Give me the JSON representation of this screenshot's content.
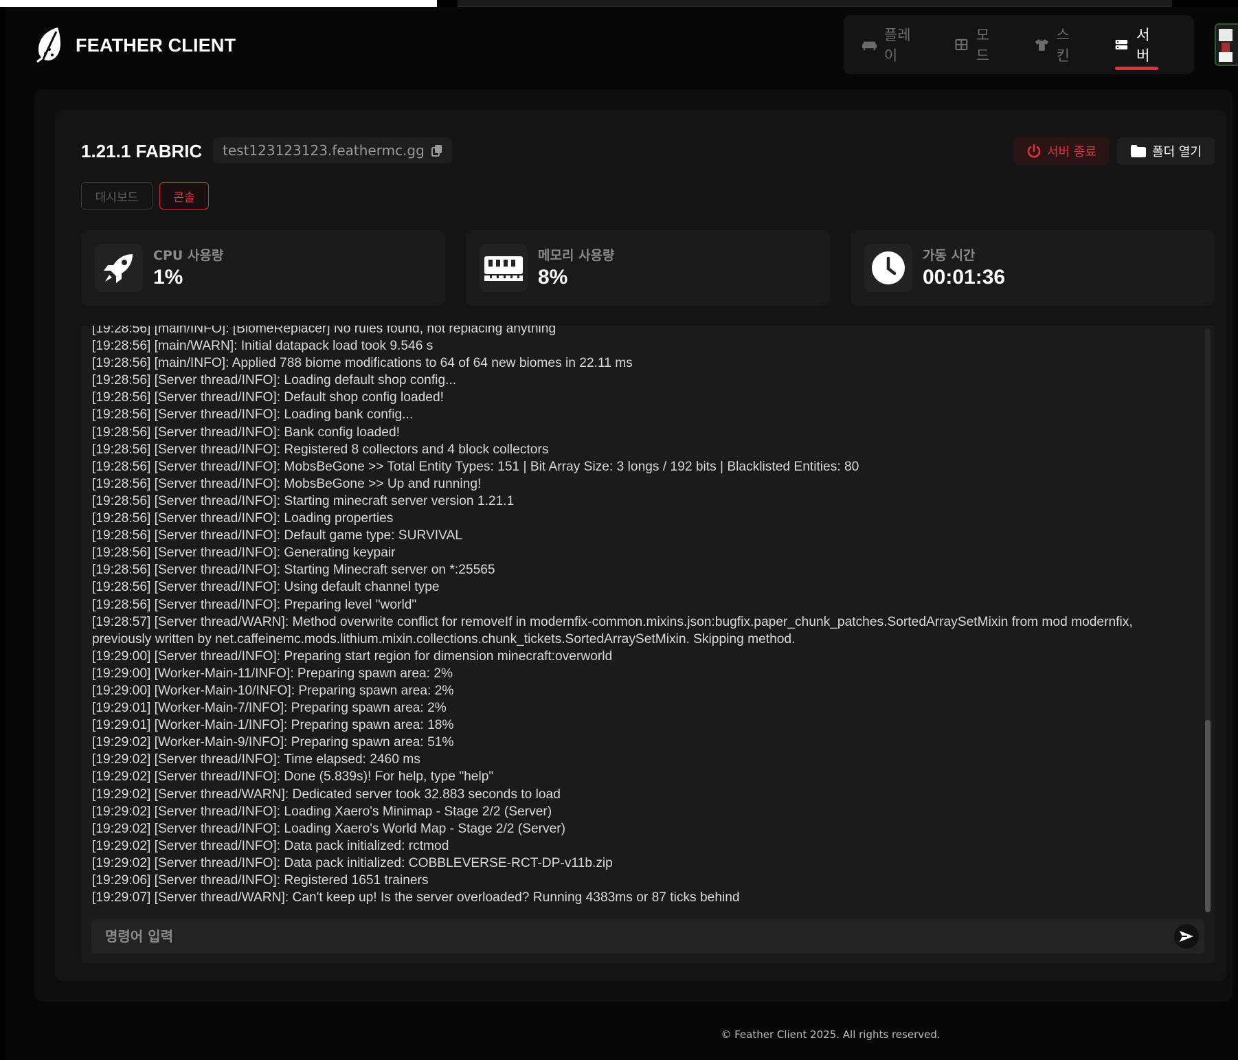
{
  "brand": {
    "name": "FEATHER CLIENT"
  },
  "nav": {
    "items": [
      {
        "label": "플레이",
        "icon": "sofa-icon",
        "active": false
      },
      {
        "label": "모드",
        "icon": "grid-icon",
        "active": false
      },
      {
        "label": "스킨",
        "icon": "shirt-icon",
        "active": false
      },
      {
        "label": "서버",
        "icon": "server-icon",
        "active": true
      }
    ]
  },
  "server": {
    "title": "1.21.1 FABRIC",
    "address": "test123123123.feathermc.gg",
    "stop_label": "서버 종료",
    "folder_label": "폴더 열기"
  },
  "tabs": {
    "dashboard": "대시보드",
    "console": "콘솔"
  },
  "stats": {
    "cpu": {
      "label": "CPU 사용량",
      "value": "1%"
    },
    "memory": {
      "label": "메모리 사용량",
      "value": "8%"
    },
    "uptime": {
      "label": "가동 시간",
      "value": "00:01:36"
    }
  },
  "console": {
    "lines": [
      "[19:28:56] [main/INFO]: [BiomeReplacer] No rules found, not replacing anything",
      "[19:28:56] [main/WARN]: Initial datapack load took 9.546 s",
      "[19:28:56] [main/INFO]: Applied 788 biome modifications to 64 of 64 new biomes in 22.11 ms",
      "[19:28:56] [Server thread/INFO]: Loading default shop config...",
      "[19:28:56] [Server thread/INFO]: Default shop config loaded!",
      "[19:28:56] [Server thread/INFO]: Loading bank config...",
      "[19:28:56] [Server thread/INFO]: Bank config loaded!",
      "[19:28:56] [Server thread/INFO]: Registered 8 collectors and 4 block collectors",
      "[19:28:56] [Server thread/INFO]: MobsBeGone >> Total Entity Types: 151 | Bit Array Size: 3 longs / 192 bits | Blacklisted Entities: 80",
      "[19:28:56] [Server thread/INFO]: MobsBeGone >> Up and running!",
      "[19:28:56] [Server thread/INFO]: Starting minecraft server version 1.21.1",
      "[19:28:56] [Server thread/INFO]: Loading properties",
      "[19:28:56] [Server thread/INFO]: Default game type: SURVIVAL",
      "[19:28:56] [Server thread/INFO]: Generating keypair",
      "[19:28:56] [Server thread/INFO]: Starting Minecraft server on *:25565",
      "[19:28:56] [Server thread/INFO]: Using default channel type",
      "[19:28:56] [Server thread/INFO]: Preparing level \"world\"",
      "[19:28:57] [Server thread/WARN]: Method overwrite conflict for removeIf in modernfix-common.mixins.json:bugfix.paper_chunk_patches.SortedArraySetMixin from mod modernfix, previously written by net.caffeinemc.mods.lithium.mixin.collections.chunk_tickets.SortedArraySetMixin. Skipping method.",
      "[19:29:00] [Server thread/INFO]: Preparing start region for dimension minecraft:overworld",
      "[19:29:00] [Worker-Main-11/INFO]: Preparing spawn area: 2%",
      "[19:29:00] [Worker-Main-10/INFO]: Preparing spawn area: 2%",
      "[19:29:01] [Worker-Main-7/INFO]: Preparing spawn area: 2%",
      "[19:29:01] [Worker-Main-1/INFO]: Preparing spawn area: 18%",
      "[19:29:02] [Worker-Main-9/INFO]: Preparing spawn area: 51%",
      "[19:29:02] [Server thread/INFO]: Time elapsed: 2460 ms",
      "[19:29:02] [Server thread/INFO]: Done (5.839s)! For help, type \"help\"",
      "[19:29:02] [Server thread/WARN]: Dedicated server took 32.883 seconds to load",
      "[19:29:02] [Server thread/INFO]: Loading Xaero's Minimap - Stage 2/2 (Server)",
      "[19:29:02] [Server thread/INFO]: Loading Xaero's World Map - Stage 2/2 (Server)",
      "[19:29:02] [Server thread/INFO]: Data pack initialized: rctmod",
      "[19:29:02] [Server thread/INFO]: Data pack initialized: COBBLEVERSE-RCT-DP-v11b.zip",
      "[19:29:06] [Server thread/INFO]: Registered 1651 trainers",
      "[19:29:07] [Server thread/WARN]: Can't keep up! Is the server overloaded? Running 4383ms or 87 ticks behind"
    ]
  },
  "command": {
    "placeholder": "명령어 입력"
  },
  "footer": {
    "text": "© Feather Client 2025. All rights reserved."
  },
  "colors": {
    "accent": "#e0323e",
    "background": "#070707",
    "panel": "#141414"
  }
}
